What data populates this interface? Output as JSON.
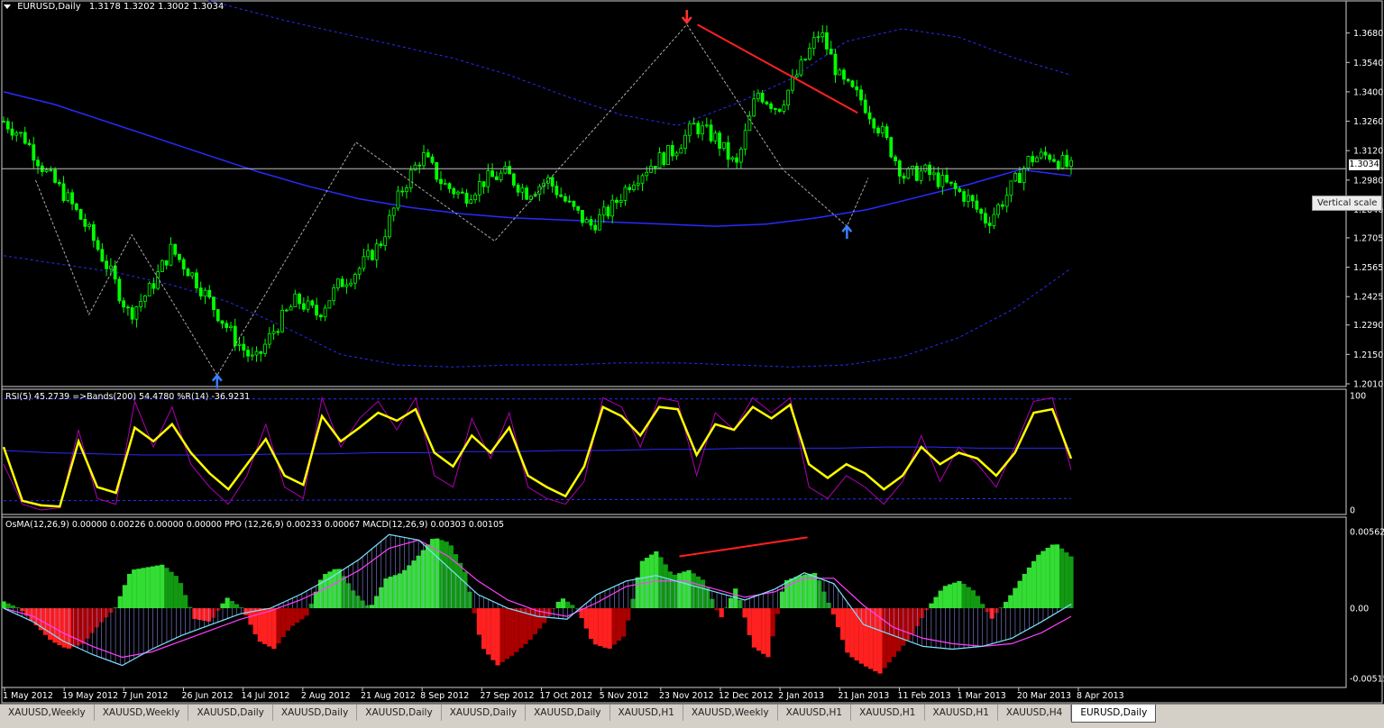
{
  "header": {
    "symbol": "EURUSD,Daily",
    "ohlc": "1.3178 1.3202 1.3002 1.3034"
  },
  "rsi_header": "RSI(5) 45.2739  =>Bands(200) 54.4780  %R(14) -36.9231",
  "osma_header": "OsMA(12,26,9) 0.00000 0.00226 0.00000 0.00000  PPO (12,26,9) 0.00233 0.00067  MACD(12,26,9) 0.00303 0.00105",
  "current_price": "1.3034",
  "tooltip": "Vertical scale",
  "colors": {
    "candle": "#00ff00",
    "ma": "#2a2aff",
    "envelope": "#2a2aff",
    "zigzag": "#aaaaaa",
    "trendline": "#ff2020",
    "rsi": "#ffff00",
    "wpr": "#b000b0",
    "hist_green_light": "#33dd33",
    "hist_green_dark": "#129912",
    "hist_red_light": "#ff2020",
    "hist_red_dark": "#aa0000",
    "macd_line": "#7fe0ff",
    "signal_line": "#ff40ff"
  },
  "tabs": [
    {
      "label": "XAUUSD,Weekly",
      "active": false
    },
    {
      "label": "XAUUSD,Weekly",
      "active": false
    },
    {
      "label": "XAUUSD,Daily",
      "active": false
    },
    {
      "label": "XAUUSD,Daily",
      "active": false
    },
    {
      "label": "XAUUSD,Daily",
      "active": false
    },
    {
      "label": "XAUUSD,Daily",
      "active": false
    },
    {
      "label": "XAUUSD,Daily",
      "active": false
    },
    {
      "label": "XAUUSD,H1",
      "active": false
    },
    {
      "label": "XAUUSD,Weekly",
      "active": false
    },
    {
      "label": "XAUUSD,H1",
      "active": false
    },
    {
      "label": "XAUUSD,H1",
      "active": false
    },
    {
      "label": "XAUUSD,H1",
      "active": false
    },
    {
      "label": "XAUUSD,H4",
      "active": false
    },
    {
      "label": "EURUSD,Daily",
      "active": true
    }
  ],
  "chart_data": [
    {
      "type": "candlestick",
      "name": "EURUSD,Daily",
      "ylim": [
        1.201,
        1.376
      ],
      "yticks": [
        "1.3680",
        "1.3540",
        "1.3400",
        "1.3260",
        "1.3120",
        "1.2980",
        "1.2840",
        "1.2705",
        "1.2565",
        "1.2425",
        "1.2290",
        "1.2150",
        "1.2010"
      ],
      "x_dates": [
        "1 May 2012",
        "19 May 2012",
        "7 Jun 2012",
        "26 Jun 2012",
        "14 Jul 2012",
        "2 Aug 2012",
        "21 Aug 2012",
        "8 Sep 2012",
        "27 Sep 2012",
        "17 Oct 2012",
        "5 Nov 2012",
        "23 Nov 2012",
        "12 Dec 2012",
        "2 Jan 2013",
        "21 Jan 2013",
        "11 Feb 2013",
        "1 Mar 2013",
        "20 Mar 2013",
        "8 Apr 2013"
      ],
      "close_path": [
        1.326,
        1.318,
        1.302,
        1.29,
        1.275,
        1.256,
        1.234,
        1.246,
        1.265,
        1.253,
        1.238,
        1.223,
        1.211,
        1.228,
        1.241,
        1.234,
        1.248,
        1.256,
        1.268,
        1.293,
        1.31,
        1.296,
        1.29,
        1.298,
        1.301,
        1.292,
        1.298,
        1.286,
        1.276,
        1.284,
        1.298,
        1.306,
        1.312,
        1.324,
        1.318,
        1.304,
        1.34,
        1.332,
        1.35,
        1.369,
        1.345,
        1.336,
        1.32,
        1.3,
        1.302,
        1.296,
        1.29,
        1.278,
        1.292,
        1.308,
        1.31,
        1.3034
      ],
      "ma_path": [
        1.34,
        1.334,
        1.326,
        1.318,
        1.31,
        1.302,
        1.295,
        1.289,
        1.285,
        1.282,
        1.28,
        1.279,
        1.278,
        1.277,
        1.276,
        1.277,
        1.28,
        1.284,
        1.29,
        1.296,
        1.303,
        1.3
      ],
      "envelope_upper": [
        1.408,
        1.402,
        1.395,
        1.388,
        1.381,
        1.374,
        1.368,
        1.362,
        1.356,
        1.348,
        1.338,
        1.329,
        1.324,
        1.334,
        1.346,
        1.364,
        1.37,
        1.366,
        1.356,
        1.348
      ],
      "envelope_lower": [
        1.262,
        1.258,
        1.254,
        1.248,
        1.24,
        1.228,
        1.215,
        1.21,
        1.209,
        1.21,
        1.21,
        1.211,
        1.211,
        1.21,
        1.209,
        1.21,
        1.214,
        1.223,
        1.237,
        1.256
      ],
      "zigzag": [
        [
          0.03,
          1.298
        ],
        [
          0.08,
          1.234
        ],
        [
          0.12,
          1.272
        ],
        [
          0.2,
          1.205
        ],
        [
          0.33,
          1.316
        ],
        [
          0.46,
          1.269
        ],
        [
          0.64,
          1.372
        ],
        [
          0.73,
          1.303
        ],
        [
          0.79,
          1.276
        ],
        [
          0.81,
          1.299
        ]
      ],
      "trendline": [
        [
          0.65,
          1.372
        ],
        [
          0.8,
          1.33
        ]
      ],
      "arrows": [
        {
          "at": 0.64,
          "value": 1.373,
          "dir": "down"
        },
        {
          "at": 0.2,
          "value": 1.205,
          "dir": "up"
        },
        {
          "at": 0.79,
          "value": 1.276,
          "dir": "up"
        }
      ]
    },
    {
      "type": "line",
      "name": "RSI(5)",
      "ylim": [
        0,
        100
      ],
      "yticks": [
        "100",
        "0"
      ],
      "series": [
        {
          "name": "RSI(5)",
          "values": [
            55,
            8,
            4,
            3,
            60,
            20,
            15,
            72,
            60,
            75,
            50,
            32,
            18,
            40,
            62,
            30,
            22,
            82,
            60,
            72,
            85,
            78,
            88,
            50,
            38,
            65,
            50,
            72,
            30,
            20,
            12,
            38,
            90,
            82,
            65,
            90,
            88,
            48,
            75,
            70,
            90,
            80,
            92,
            40,
            28,
            40,
            32,
            18,
            30,
            55,
            40,
            50,
            45,
            30,
            50,
            85,
            88,
            45
          ]
        },
        {
          "name": "=>Bands(200)",
          "values": [
            52,
            50,
            49,
            48,
            48,
            48,
            49,
            49,
            50,
            50,
            51,
            51,
            52,
            52,
            53,
            53,
            54,
            54,
            54,
            55,
            55,
            54,
            54,
            54
          ]
        },
        {
          "name": "%R(14)",
          "values": [
            40,
            5,
            0,
            2,
            70,
            10,
            5,
            95,
            55,
            90,
            40,
            20,
            5,
            30,
            75,
            20,
            10,
            98,
            55,
            80,
            95,
            70,
            98,
            30,
            20,
            80,
            45,
            85,
            20,
            10,
            5,
            25,
            98,
            90,
            55,
            98,
            95,
            30,
            85,
            70,
            98,
            85,
            98,
            20,
            10,
            30,
            20,
            5,
            25,
            65,
            25,
            55,
            40,
            20,
            55,
            95,
            98,
            35
          ]
        }
      ]
    },
    {
      "type": "bar",
      "name": "OsMA(12,26,9)",
      "ylim": [
        -0.00515,
        0.00562
      ],
      "yticks": [
        "0.00562",
        "0.00",
        "-0.00515"
      ],
      "histogram": [
        0.0005,
        0,
        -0.0012,
        -0.0024,
        -0.003,
        -0.0026,
        -0.0012,
        0,
        0.0028,
        0.003,
        0.0032,
        0.0022,
        -0.0008,
        -0.001,
        0.0008,
        0,
        -0.0024,
        -0.003,
        -0.0014,
        -0.0006,
        0.0024,
        0.003,
        0.0012,
        0,
        0.0022,
        0.0026,
        0.0038,
        0.0052,
        0.0048,
        0.0026,
        -0.0028,
        -0.0042,
        -0.0034,
        -0.0024,
        -0.001,
        0.0008,
        0,
        -0.0026,
        -0.003,
        -0.002,
        0.0034,
        0.0042,
        0.0024,
        0.0028,
        0.002,
        -0.0008,
        0.0016,
        -0.0028,
        -0.0036,
        0.002,
        0.0024,
        0.0026,
        -0.0002,
        -0.0034,
        -0.0042,
        -0.0048,
        -0.0034,
        -0.002,
        0,
        0.0016,
        0.002,
        0.0012,
        -0.0008,
        0.0006,
        0.0024,
        0.004,
        0.0048,
        0.0038
      ],
      "series": [
        {
          "name": "MACD(12,26,9)",
          "values": [
            0,
            -0.001,
            -0.0024,
            -0.0034,
            -0.0042,
            -0.003,
            -0.002,
            -0.0012,
            -0.0004,
            0,
            0.001,
            0.0022,
            0.0036,
            0.0054,
            0.005,
            0.003,
            0.001,
            0.0,
            -0.0006,
            -0.0008,
            0.001,
            0.002,
            0.0024,
            0.0018,
            0.0012,
            0.0006,
            0.0014,
            0.0026,
            0.0018,
            -0.0012,
            -0.002,
            -0.0028,
            -0.003,
            -0.0028,
            -0.0022,
            -0.001,
            0.0003
          ]
        },
        {
          "name": "PPO (12,26,9)",
          "values": [
            0,
            -0.0006,
            -0.0018,
            -0.0028,
            -0.0036,
            -0.0032,
            -0.0024,
            -0.0016,
            -0.0008,
            -0.0002,
            0.0006,
            0.0016,
            0.0028,
            0.0044,
            0.005,
            0.0038,
            0.002,
            0.0006,
            -0.0002,
            -0.0006,
            0.0004,
            0.0016,
            0.002,
            0.002,
            0.0014,
            0.0008,
            0.0012,
            0.0022,
            0.0022,
            0.0002,
            -0.0014,
            -0.0022,
            -0.0026,
            -0.0028,
            -0.0026,
            -0.0018,
            -0.0006
          ]
        }
      ],
      "trendline": [
        [
          0.633,
          0.0038
        ],
        [
          0.753,
          0.0052
        ]
      ]
    }
  ]
}
